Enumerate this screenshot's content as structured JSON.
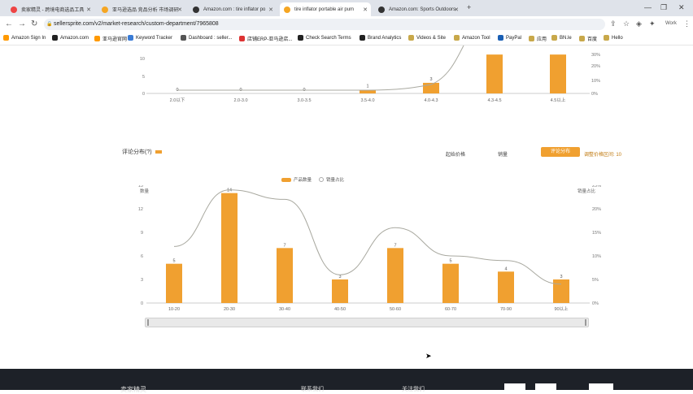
{
  "browser": {
    "tabs": [
      {
        "title": "卖家精灵 - 跨境电商选品工具",
        "color": "#e44"
      },
      {
        "title": "亚马逊选品 竞品分析 市场调研",
        "color": "#f5a623"
      },
      {
        "title": "Amazon.com : tire inflator po",
        "color": "#333"
      },
      {
        "title": "tire inflator portable air pum",
        "color": "#f5a623"
      },
      {
        "title": "Amazon.com: Sports Outdoors",
        "color": "#333"
      }
    ],
    "url": "sellersprite.com/v2/market-research/custom-department/7965808",
    "new_tab": "+",
    "profile_label": "Work"
  },
  "bookmarks": [
    {
      "label": "Amazon Sign In"
    },
    {
      "label": "Amazon.com"
    },
    {
      "label": "亚马逊官网"
    },
    {
      "label": "Keyword Tracker"
    },
    {
      "label": "Dashboard : seller..."
    },
    {
      "label": "店铺ERP-亚马逊店..."
    },
    {
      "label": "Check Search Terms"
    },
    {
      "label": "Brand Analytics"
    },
    {
      "label": "Videos & Site"
    },
    {
      "label": "Amazon Tool"
    },
    {
      "label": "PayPal"
    },
    {
      "label": "应用"
    },
    {
      "label": "BN.le"
    },
    {
      "label": "百度"
    },
    {
      "label": "Hello"
    }
  ],
  "top_chart": {
    "y_ticks": [
      "10",
      "5",
      "0"
    ],
    "y2_ticks": [
      "30%",
      "20%",
      "10%",
      "0%"
    ],
    "categories": [
      "2.0以下",
      "2.0-3.0",
      "3.0-3.5",
      "3.5-4.0",
      "4.0-4.3",
      "4.3-4.5",
      "4.5以上"
    ],
    "values": [
      0,
      0,
      0,
      1,
      3,
      11,
      11
    ],
    "bar_labels": [
      "0",
      "0",
      "0",
      "1",
      "3",
      "",
      ""
    ]
  },
  "section": {
    "title": "评论分布(?)",
    "controls": [
      "起始价格",
      "销量",
      "评论分布",
      "调整价格区间: 10"
    ]
  },
  "chart_data": {
    "type": "bar",
    "categories": [
      "10-20",
      "20-30",
      "30-40",
      "40-50",
      "50-60",
      "60-70",
      "70-90",
      "90以上"
    ],
    "series": [
      {
        "name": "产品数量",
        "type": "bar",
        "values": [
          5,
          14,
          7,
          3,
          7,
          5,
          4,
          3
        ]
      },
      {
        "name": "销量占比",
        "type": "line",
        "values": [
          12,
          24,
          22,
          6,
          16,
          10,
          9,
          4
        ]
      }
    ],
    "legend": [
      "产品数量",
      "销量占比"
    ],
    "ylabel": "数量",
    "y2label": "销量占比",
    "y_ticks": [
      "15",
      "12",
      "9",
      "6",
      "3",
      "0"
    ],
    "y2_ticks": [
      "25%",
      "20%",
      "15%",
      "10%",
      "5%",
      "0%"
    ],
    "ylim": [
      0,
      15
    ],
    "y2lim": [
      0,
      25
    ],
    "bar_color": "#f0a030"
  },
  "footer": {
    "brand": "卖家精灵",
    "col1": "联系我们",
    "col2": "关注我们"
  }
}
